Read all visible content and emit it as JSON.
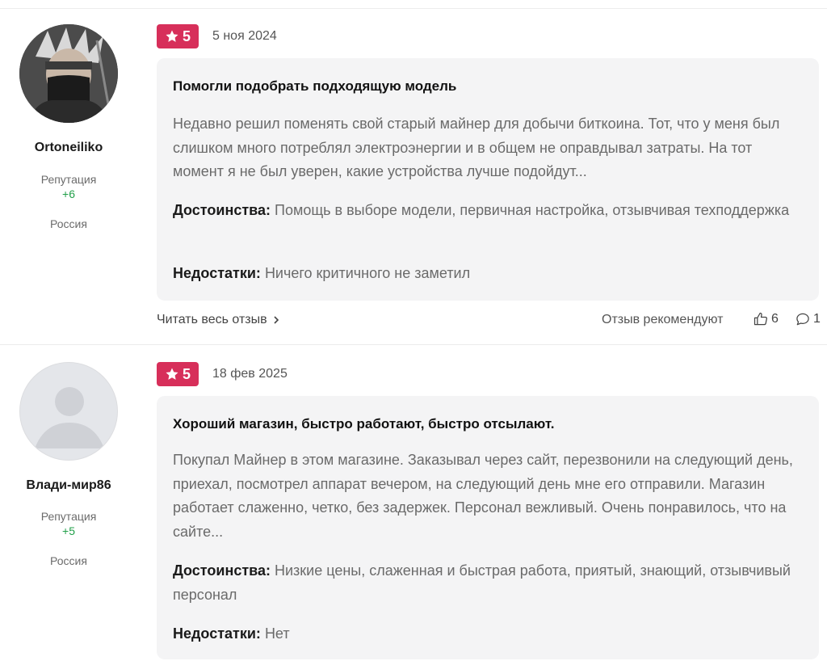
{
  "reviews": [
    {
      "author": {
        "name": "Ortoneiliko",
        "reputation_label": "Репутация",
        "reputation_value": "+6",
        "country": "Россия"
      },
      "rating": "5",
      "date": "5 ноя 2024",
      "title": "Помогли подобрать подходящую модель",
      "body": "Недавно решил поменять свой старый майнер для добычи биткоина. Тот, что у меня был слишком много потреблял электроэнергии и в общем не оправдывал затраты. На тот момент я не был уверен, какие устройства лучше подойдут...",
      "pros_label": "Достоинства:",
      "pros": "Помощь в выборе модели, первичная настройка, отзывчивая техподдержка",
      "cons_label": "Недостатки:",
      "cons": "Ничего критичного не заметил",
      "read_more": "Читать весь отзыв",
      "recommend_label": "Отзыв рекомендуют",
      "likes": "6",
      "comments": "1"
    },
    {
      "author": {
        "name": "Влади-мир86",
        "reputation_label": "Репутация",
        "reputation_value": "+5",
        "country": "Россия"
      },
      "rating": "5",
      "date": "18 фев 2025",
      "title": "Хороший магазин, быстро работают, быстро отсылают.",
      "body": "Покупал Майнер в этом магазине. Заказывал через сайт, перезвонили на следующий день, приехал, посмотрел аппарат вечером, на следующий день мне его отправили. Магазин работает слаженно, четко, без задержек. Персонал вежливый. Очень понравилось, что на сайте...",
      "pros_label": "Достоинства:",
      "pros": "Низкие цены, слаженная и быстрая работа, приятый, знающий, отзывчивый персонал",
      "cons_label": "Недостатки:",
      "cons": "Нет"
    }
  ],
  "colors": {
    "rating_badge": "#d72f5a",
    "reputation": "#22a04a",
    "card_bg": "#f4f4f5"
  },
  "icons": {
    "rating": "star-icon",
    "read_more": "chevron-right-icon",
    "likes": "thumbs-up-icon",
    "comments": "comment-icon"
  }
}
